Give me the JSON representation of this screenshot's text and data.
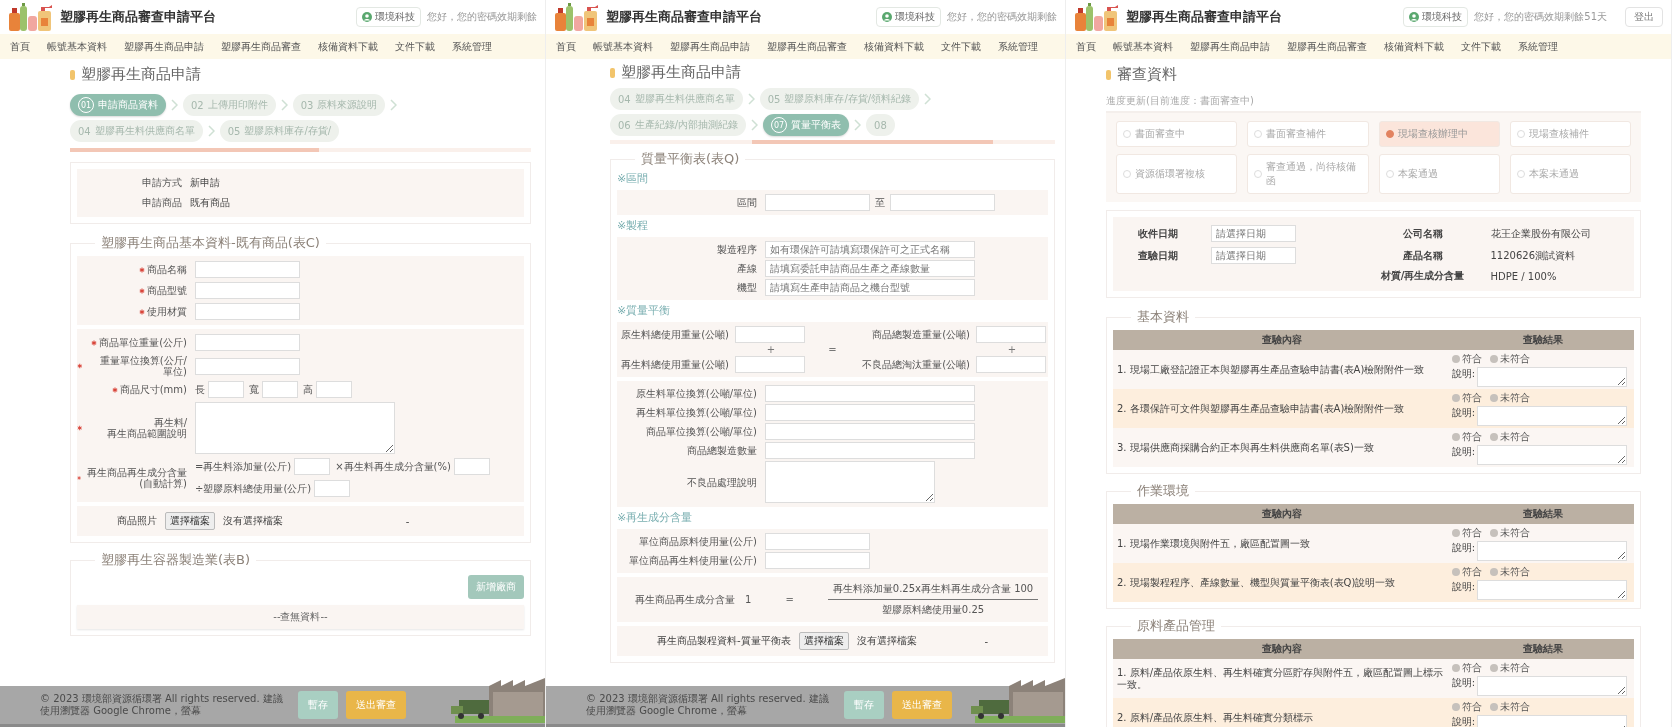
{
  "screens": [
    {
      "kind": "product_application",
      "header": {
        "title": "塑膠再生商品審查申請平台",
        "user": "環境科技",
        "greeting": "您好，您的密碼效期剩餘"
      },
      "nav": [
        "首頁",
        "帳號基本資料",
        "塑膠再生商品申請",
        "塑膠再生商品審查",
        "核備資料下載",
        "文件下載",
        "系統管理"
      ],
      "page_title": "塑膠再生商品申請",
      "steps": [
        {
          "number": "01",
          "label": "申請商品資料",
          "selected": true
        },
        {
          "number": "02",
          "label": "上傳用印附件",
          "selected": false
        },
        {
          "number": "03",
          "label": "原料來源說明",
          "selected": false
        },
        {
          "number": "04",
          "label": "塑膠再生料供應商名單",
          "selected": false
        },
        {
          "number": "05",
          "label": "塑膠原料庫存/存貨/",
          "selected": false
        }
      ],
      "summary": [
        {
          "label": "申請方式",
          "value": "新申請"
        },
        {
          "label": "申請商品",
          "value": "既有商品"
        }
      ],
      "sections": [
        {
          "title": "塑膠再生商品基本資料-既有商品(表C)",
          "blocks": [
            {
              "rows": [
                {
                  "kind": "input",
                  "label": "商品名稱",
                  "required": true
                },
                {
                  "kind": "input",
                  "label": "商品型號",
                  "required": true
                },
                {
                  "kind": "input",
                  "label": "使用材質",
                  "required": true
                }
              ]
            },
            {
              "rows": [
                {
                  "kind": "input",
                  "label": "商品單位重量(公斤)",
                  "required": true
                },
                {
                  "kind": "input",
                  "label": "重量單位換算(公斤/單位)",
                  "required": true
                },
                {
                  "kind": "dimensions",
                  "label": "商品尺寸(mm)",
                  "required": true,
                  "parts": [
                    "長",
                    "寬",
                    "高"
                  ]
                },
                {
                  "kind": "textarea",
                  "label": "再生料/再生商品範圍說明",
                  "required": true
                },
                {
                  "kind": "calc",
                  "label": "再生商品再生成分含量(自動計算)",
                  "required": true,
                  "parts": [
                    "=再生料添加量(公斤)",
                    "×再生料再生成分含量(%)",
                    "÷塑膠原料總使用量(公斤)"
                  ]
                }
              ]
            },
            {
              "rows": [
                {
                  "kind": "file",
                  "label": "商品照片",
                  "button": "選擇檔案",
                  "status": "沒有選擇檔案",
                  "note": "-"
                }
              ]
            }
          ]
        },
        {
          "title": "塑膠再生容器製造業(表B)",
          "action": "新增廠商",
          "empty": "--查無資料--"
        }
      ],
      "footer": {
        "copyright": "© 2023 環境部資源循環署 All rights reserved. 建議使用瀏覽器 Google Chrome，螢幕",
        "buttons": [
          {
            "kind": "save",
            "label": "暫存"
          },
          {
            "kind": "submit",
            "label": "送出審查"
          }
        ]
      }
    },
    {
      "kind": "mass_balance",
      "header": {
        "title": "塑膠再生商品審查申請平台",
        "user": "環境科技",
        "greeting": "您好，您的密碼效期剩餘"
      },
      "nav": [
        "首頁",
        "帳號基本資料",
        "塑膠再生商品申請",
        "塑膠再生商品審查",
        "核備資料下載",
        "文件下載",
        "系統管理"
      ],
      "page_title": "塑膠再生商品申請",
      "steps": [
        {
          "number": "04",
          "label": "塑膠再生料供應商名單",
          "selected": false
        },
        {
          "number": "05",
          "label": "塑膠原料庫存/存貨/領料紀錄",
          "selected": false
        },
        {
          "number": "06",
          "label": "生產紀錄/內部抽測紀錄",
          "selected": false
        },
        {
          "number": "07",
          "label": "質量平衡表",
          "selected": true
        },
        {
          "number": "08",
          "selected": false
        }
      ],
      "sections": [
        {
          "title": "質量平衡表(表Q)",
          "blocks": [
            {
              "heading": "※區間",
              "rows": [
                {
                  "kind": "range",
                  "label": "區間",
                  "separator": "至"
                }
              ]
            },
            {
              "heading": "※製程",
              "rows": [
                {
                  "kind": "long_input",
                  "label": "製造程序",
                  "placeholder": "如有環保許可請填寫環保許可之正式名稱"
                },
                {
                  "kind": "long_input",
                  "label": "產線",
                  "placeholder": "請填寫委託申請商品生產之產線數量"
                },
                {
                  "kind": "long_input",
                  "label": "機型",
                  "placeholder": "請填寫生產申請商品之機台型號"
                }
              ]
            },
            {
              "heading": "※質量平衡",
              "rows": [
                {
                  "kind": "balance",
                  "left": [
                    "原生料總使用重量(公噸)",
                    "再生料總使用重量(公噸)"
                  ],
                  "right": [
                    "商品總製造重量(公噸)",
                    "不良品總淘汰重量(公噸)"
                  ],
                  "left_op": "+",
                  "equals": "=",
                  "right_op": "+"
                }
              ]
            },
            {
              "rows": [
                {
                  "kind": "long_input",
                  "label": "原生料單位換算(公噸/單位)"
                },
                {
                  "kind": "long_input",
                  "label": "再生料單位換算(公噸/單位)"
                },
                {
                  "kind": "long_input",
                  "label": "商品單位換算(公噸/單位)"
                },
                {
                  "kind": "long_input",
                  "label": "商品總製造數量"
                },
                {
                  "kind": "textarea",
                  "label": "不良品處理說明"
                }
              ]
            },
            {
              "heading": "※再生成分含量",
              "rows": [
                {
                  "kind": "input",
                  "label": "單位商品原料使用量(公斤)"
                },
                {
                  "kind": "input",
                  "label": "單位商品再生料使用量(公斤)"
                }
              ]
            },
            {
              "rows": [
                {
                  "kind": "formula",
                  "label": "再生商品再生成分含量",
                  "value": "1",
                  "equals": "=",
                  "numerator": "再生料添加量0.25x再生料再生成分含量 100",
                  "denominator": "塑膠原料總使用量0.25"
                }
              ]
            },
            {
              "rows": [
                {
                  "kind": "file",
                  "label": "再生商品製程資料-質量平衡表",
                  "button": "選擇檔案",
                  "status": "沒有選擇檔案",
                  "note": "-"
                }
              ]
            }
          ]
        }
      ],
      "footer": {
        "copyright": "© 2023 環境部資源循環署 All rights reserved. 建議使用瀏覽器 Google Chrome，螢幕",
        "buttons": [
          {
            "kind": "save",
            "label": "暫存"
          },
          {
            "kind": "submit",
            "label": "送出審查"
          }
        ]
      }
    },
    {
      "kind": "review",
      "header": {
        "title": "塑膠再生商品審查申請平台",
        "user": "環境科技",
        "greeting": "您好，您的密碼效期剩餘51天",
        "logout": "登出"
      },
      "nav": [
        "首頁",
        "帳號基本資料",
        "塑膠再生商品申請",
        "塑膠再生商品審查",
        "核備資料下載",
        "文件下載",
        "系統管理"
      ],
      "page_title": "審查資料",
      "progress": {
        "caption": "進度更新(目前進度：書面審查中)",
        "options": [
          {
            "label": "書面審查中",
            "selected": false
          },
          {
            "label": "書面審查補件",
            "selected": false
          },
          {
            "label": "現場查核辦理中",
            "selected": true
          },
          {
            "label": "現場查核補件",
            "selected": false
          },
          {
            "label": "資源循環署複核",
            "selected": false
          },
          {
            "label": "審查通過，尚待核備函",
            "selected": false
          },
          {
            "label": "本案通過",
            "selected": false
          },
          {
            "label": "本案未通過",
            "selected": false
          }
        ]
      },
      "info": {
        "dates": [
          {
            "label": "收件日期",
            "placeholder": "請選擇日期"
          },
          {
            "label": "查驗日期",
            "placeholder": "請選擇日期"
          }
        ],
        "facts": [
          {
            "label": "公司名稱",
            "value": "花王企業股份有限公司"
          },
          {
            "label": "產品名稱",
            "value": "1120626測試資料"
          },
          {
            "label": "材質/再生成分含量",
            "value": "HDPE / 100%"
          }
        ]
      },
      "checklists": [
        {
          "title": "基本資料",
          "columns": [
            "查驗內容",
            "查驗結果"
          ],
          "items": [
            {
              "text": "1. 現場工廠登記證正本與塑膠再生產品查驗申請書(表A)檢附附件一致",
              "options": [
                {
                  "label": "符合",
                  "selected": false
                },
                {
                  "label": "未符合",
                  "selected": false
                }
              ],
              "note_label": "說明:"
            },
            {
              "text": "2. 各環保許可文件與塑膠再生產品查驗申請書(表A)檢附附件一致",
              "options": [
                {
                  "label": "符合",
                  "selected": false
                },
                {
                  "label": "未符合",
                  "selected": false
                }
              ],
              "note_label": "說明:"
            },
            {
              "text": "3. 現場供應商採購合約正本與再生料供應商名單(表S)一致",
              "options": [
                {
                  "label": "符合",
                  "selected": false
                },
                {
                  "label": "未符合",
                  "selected": false
                }
              ],
              "note_label": "說明:"
            }
          ]
        },
        {
          "title": "作業環境",
          "columns": [
            "查驗內容",
            "查驗結果"
          ],
          "items": [
            {
              "text": "1. 現場作業環境與附件五，廠區配置圖一致",
              "options": [
                {
                  "label": "符合",
                  "selected": false
                },
                {
                  "label": "未符合",
                  "selected": false
                }
              ],
              "note_label": "說明:"
            },
            {
              "text": "2. 現場製程程序、產線數量、機型與質量平衡表(表Q)說明一致",
              "options": [
                {
                  "label": "符合",
                  "selected": false
                },
                {
                  "label": "未符合",
                  "selected": false
                }
              ],
              "note_label": "說明:"
            }
          ]
        },
        {
          "title": "原料產品管理",
          "columns": [
            "查驗內容",
            "查驗結果"
          ],
          "items": [
            {
              "text": "1. 原料/產品依原生料、再生料確實分區貯存與附件五，廠區配置圖上標示一致。",
              "options": [
                {
                  "label": "符合",
                  "selected": false
                },
                {
                  "label": "未符合",
                  "selected": false
                }
              ],
              "note_label": "說明:"
            },
            {
              "text": "2. 原料/產品依原生料、再生料確實分類標示",
              "options": [
                {
                  "label": "符合",
                  "selected": false
                },
                {
                  "label": "未符合",
                  "selected": false
                }
              ],
              "note_label": "說明:"
            }
          ]
        }
      ]
    }
  ]
}
